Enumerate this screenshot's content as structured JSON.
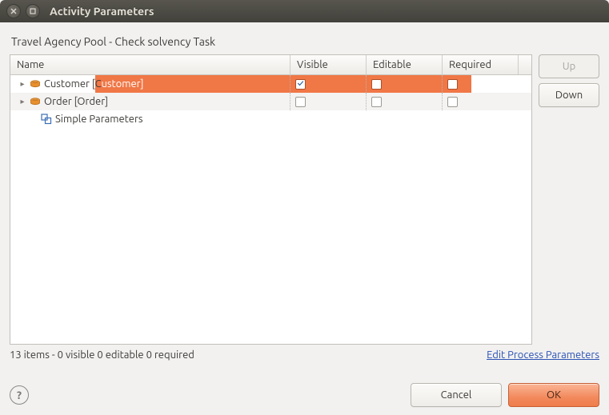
{
  "window": {
    "title": "Activity Parameters"
  },
  "subtitle": "Travel Agency Pool  - Check solvency Task",
  "columns": {
    "name": "Name",
    "visible": "Visible",
    "editable": "Editable",
    "required": "Required"
  },
  "rows": [
    {
      "kind": "class",
      "label_plain": "Customer [Customer]",
      "label_prefix": "Customer [C",
      "label_highlight": "ustomer]",
      "expanded": false,
      "selected": true,
      "visible": true,
      "editable": false,
      "required": false,
      "indent": 1
    },
    {
      "kind": "class",
      "label_plain": "Order [Order]",
      "expanded": false,
      "selected": false,
      "visible": false,
      "editable": false,
      "required": false,
      "indent": 1
    },
    {
      "kind": "simple",
      "label_plain": "Simple Parameters",
      "expanded": null,
      "selected": false,
      "indent": 2
    }
  ],
  "side": {
    "up": "Up",
    "down": "Down"
  },
  "status": "13 items - 0 visible  0 editable  0 required",
  "link": "Edit Process Parameters",
  "footer": {
    "cancel": "Cancel",
    "ok": "OK"
  }
}
